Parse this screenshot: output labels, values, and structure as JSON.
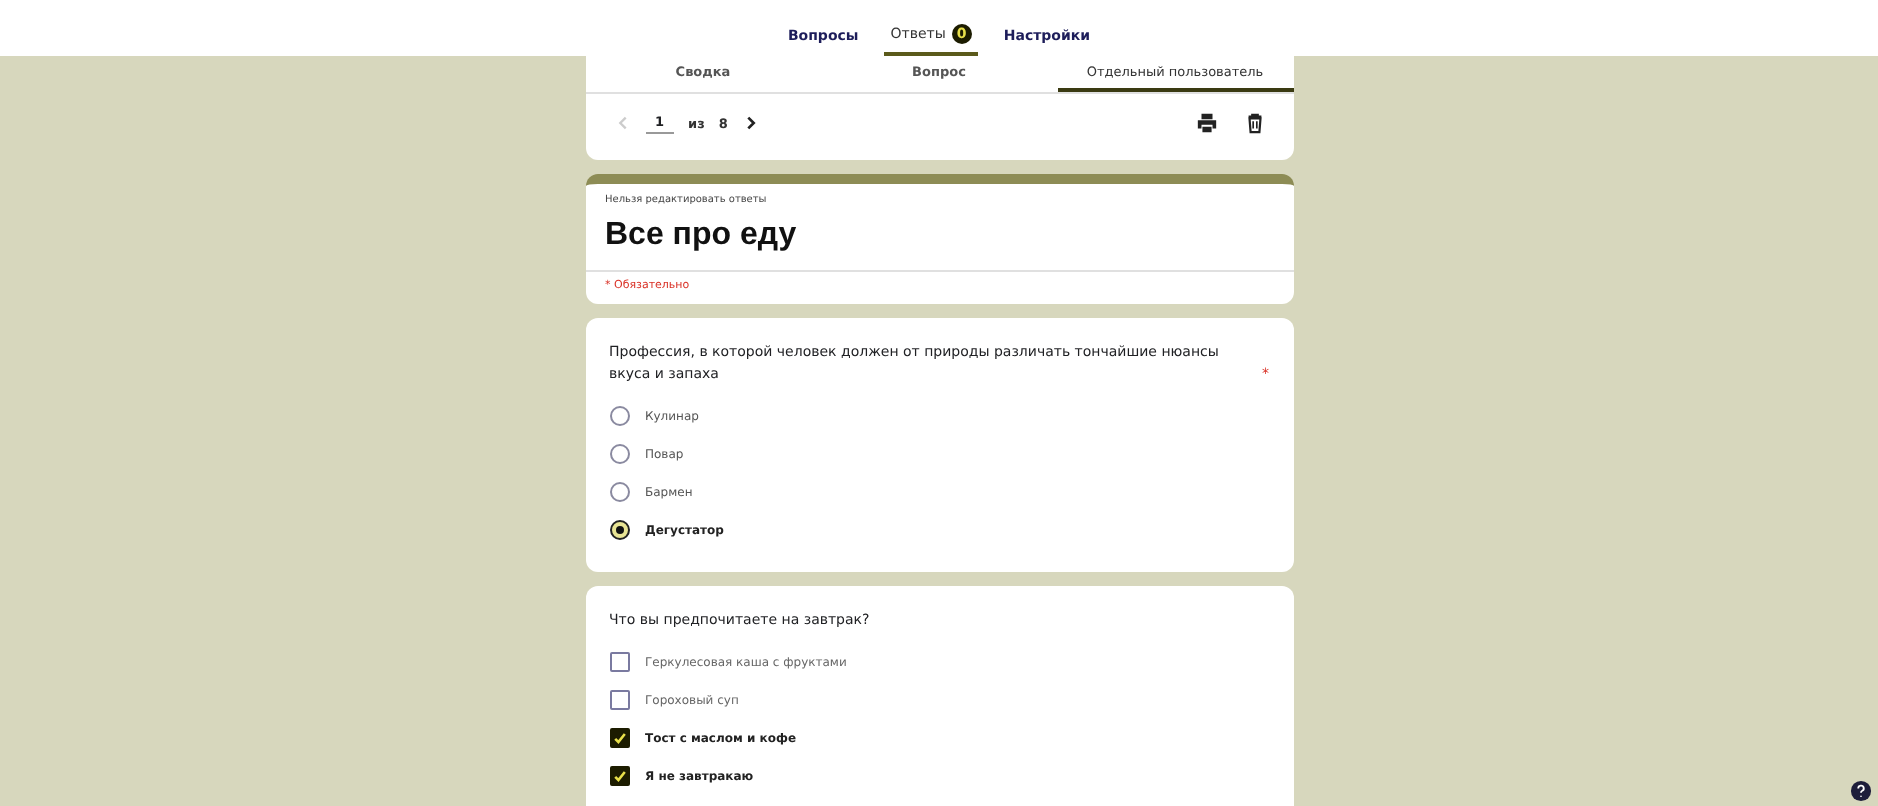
{
  "top_tabs": [
    {
      "label": "Вопросы",
      "selected": false
    },
    {
      "label": "Ответы",
      "selected": true,
      "badge": "0"
    },
    {
      "label": "Настройки",
      "selected": false
    }
  ],
  "sub_tabs": [
    {
      "label": "Сводка",
      "selected": false
    },
    {
      "label": "Вопрос",
      "selected": false
    },
    {
      "label": "Отдельный пользователь",
      "selected": true
    }
  ],
  "pager": {
    "current": "1",
    "of": "из",
    "total": "8"
  },
  "form": {
    "notice": "Нельзя редактировать ответы",
    "title": "Все про еду",
    "required_note": "* Обязательно"
  },
  "questions": [
    {
      "kind": "radio",
      "text": "Профессия, в которой человек должен от природы различать тончайшие нюансы вкуса и запаха",
      "required_mark": "*",
      "options": [
        {
          "label": "Кулинар",
          "selected": false
        },
        {
          "label": "Повар",
          "selected": false
        },
        {
          "label": "Бармен",
          "selected": false
        },
        {
          "label": "Дегустатор",
          "selected": true
        }
      ]
    },
    {
      "kind": "checkbox",
      "text": "Что вы предпочитаете на завтрак?",
      "options": [
        {
          "label": "Геркулесовая каша с фруктами",
          "checked": false
        },
        {
          "label": "Гороховый суп",
          "checked": false
        },
        {
          "label": "Тост с маслом и кофе",
          "checked": true
        },
        {
          "label": "Я не завтракаю",
          "checked": true
        }
      ]
    }
  ]
}
